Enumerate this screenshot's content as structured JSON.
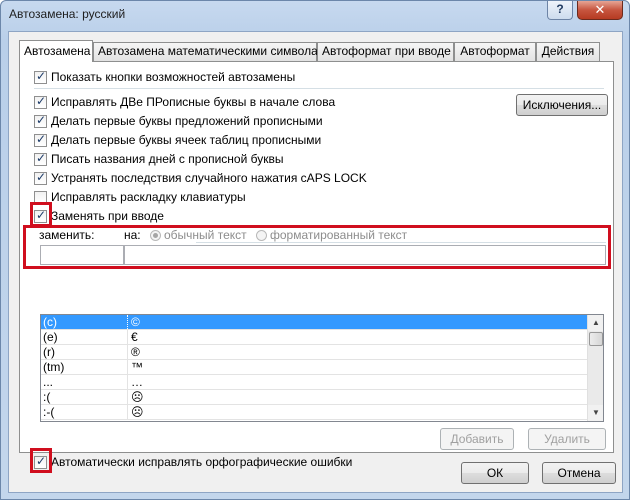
{
  "window": {
    "title": "Автозамена: русский",
    "help_glyph": "?",
    "close_glyph": "✕"
  },
  "tabs": [
    {
      "label": "Автозамена",
      "active": true
    },
    {
      "label": "Автозамена математическими символами"
    },
    {
      "label": "Автоформат при вводе"
    },
    {
      "label": "Автоформат"
    },
    {
      "label": "Действия"
    }
  ],
  "options": {
    "show_buttons": {
      "label": "Показать кнопки возможностей автозамены",
      "checked": true
    },
    "fix_two_caps": {
      "label": "Исправлять ДВе ПРописные буквы в начале слова",
      "checked": true
    },
    "capitalize_sentences": {
      "label": "Делать первые буквы предложений прописными",
      "checked": true
    },
    "capitalize_table_cells": {
      "label": "Делать первые буквы ячеек таблиц прописными",
      "checked": true
    },
    "capitalize_days": {
      "label": "Писать названия дней с прописной буквы",
      "checked": true
    },
    "fix_caps_lock": {
      "label": "Устранять последствия случайного нажатия cAPS LOCK",
      "checked": true
    },
    "fix_keyboard_layout": {
      "label": "Исправлять раскладку клавиатуры",
      "checked": false
    },
    "replace_as_type": {
      "label": "Заменять при вводе",
      "checked": true
    },
    "auto_spelling": {
      "label": "Автоматически исправлять орфографические ошибки",
      "checked": true
    }
  },
  "exceptions_button": "Исключения...",
  "replace_label": "заменить:",
  "with_label": "на:",
  "radio_plain": "обычный текст",
  "radio_formatted": "форматированный текст",
  "replace_value": "",
  "with_value": "",
  "entries": [
    {
      "replace": "(c)",
      "with": "©"
    },
    {
      "replace": "(e)",
      "with": "€"
    },
    {
      "replace": "(r)",
      "with": "®"
    },
    {
      "replace": "(tm)",
      "with": "™"
    },
    {
      "replace": "...",
      "with": "…"
    },
    {
      "replace": ":(",
      "with": "☹"
    },
    {
      "replace": ":-(",
      "with": "☹"
    }
  ],
  "add_button": "Добавить",
  "delete_button": "Удалить",
  "ok_button": "ОК",
  "cancel_button": "Отмена",
  "colors": {
    "highlight": "#d00e1e",
    "selection": "#3399ff"
  }
}
